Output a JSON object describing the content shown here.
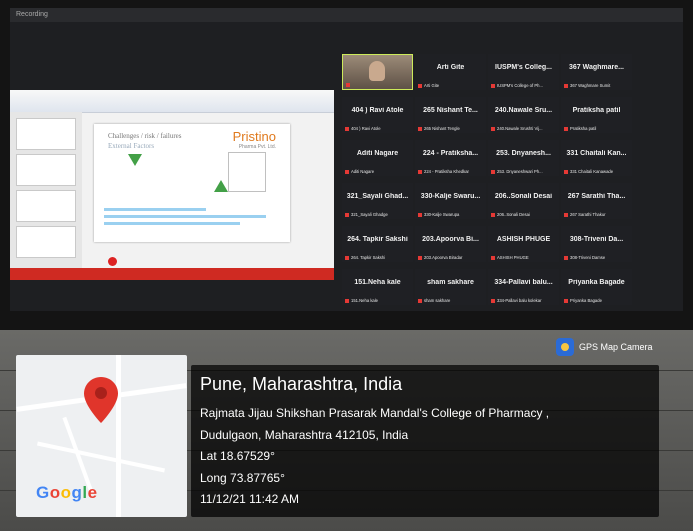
{
  "screen": {
    "window_title": "Recording",
    "slide": {
      "title": "Challenges / risk / failures",
      "subtitle": "External Factors",
      "logo": "Pristino",
      "logo_sub": "Pharma Pvt. Ltd."
    }
  },
  "participants": [
    {
      "name": "",
      "sub": "",
      "video": true
    },
    {
      "name": "Arti Gite",
      "sub": "Arti Gite",
      "video": false
    },
    {
      "name": "IUSPM's Colleg...",
      "sub": "IUSPM's College of Ph...",
      "video": false
    },
    {
      "name": "367 Waghmare...",
      "sub": "367 Waghmare Sumit",
      "video": false
    },
    {
      "name": "404 ) Ravi Atole",
      "sub": "404 ) Ravi Atole",
      "video": false
    },
    {
      "name": "265 Nishant Te...",
      "sub": "265 Nishant Tengle",
      "video": false
    },
    {
      "name": "240.Nawale Sru...",
      "sub": "240.Nawale Srushti Vij...",
      "video": false
    },
    {
      "name": "Pratiksha patil",
      "sub": "Pratiksha patil",
      "video": false
    },
    {
      "name": "Aditi Nagare",
      "sub": "Aditi Nagare",
      "video": false
    },
    {
      "name": "224 - Pratiksha...",
      "sub": "224 - Pratiksha Khedkar",
      "video": false
    },
    {
      "name": "253. Dnyanesh...",
      "sub": "253. Dnyaneshwari Ph...",
      "video": false
    },
    {
      "name": "331 Chaitali Kan...",
      "sub": "331 Chaitali Kanawade",
      "video": false
    },
    {
      "name": "321_Sayali Ghad...",
      "sub": "321_Sayali Ghadge",
      "video": false
    },
    {
      "name": "330-Kalje Swaru...",
      "sub": "330-Kalje Swarupa",
      "video": false
    },
    {
      "name": "206..Sonali Desai",
      "sub": "206..Sonali Desai",
      "video": false
    },
    {
      "name": "267 Sarathi Tha...",
      "sub": "267 Sarathi Thakur",
      "video": false
    },
    {
      "name": "264. Tapkir Sakshi",
      "sub": "264. Tapkir Sakshi",
      "video": false
    },
    {
      "name": "203.Apoorva Bi...",
      "sub": "203.Apoorva Biradar",
      "video": false
    },
    {
      "name": "ASHISH PHUGE",
      "sub": "ASHISH PHUGE",
      "video": false
    },
    {
      "name": "308-Triveni Da...",
      "sub": "308-Triveni Damse",
      "video": false
    },
    {
      "name": "151.Neha kale",
      "sub": "151.Neha kale",
      "video": false
    },
    {
      "name": "sham sakhare",
      "sub": "sham sakhare",
      "video": false
    },
    {
      "name": "334-Pallavi balu...",
      "sub": "334-Pallavi balu kolekar",
      "video": false
    },
    {
      "name": "Priyanka Bagade",
      "sub": "Priyanka Bagade",
      "video": false
    }
  ],
  "gps": {
    "badge_label": "GPS Map Camera",
    "map_brand": "Google",
    "location_title": "Pune, Maharashtra, India",
    "address_line1": "Rajmata Jijau Shikshan Prasarak Mandal's College of Pharmacy ,",
    "address_line2": "Dudulgaon, Maharashtra 412105, India",
    "lat": "Lat 18.67529°",
    "long": "Long 73.87765°",
    "timestamp": "11/12/21 11:42 AM"
  },
  "colors": {
    "pin": "#e0352b",
    "active_speaker_border": "#cdea5a",
    "mic_muted": "#e53935",
    "slide_accent": "#e07a1e"
  }
}
